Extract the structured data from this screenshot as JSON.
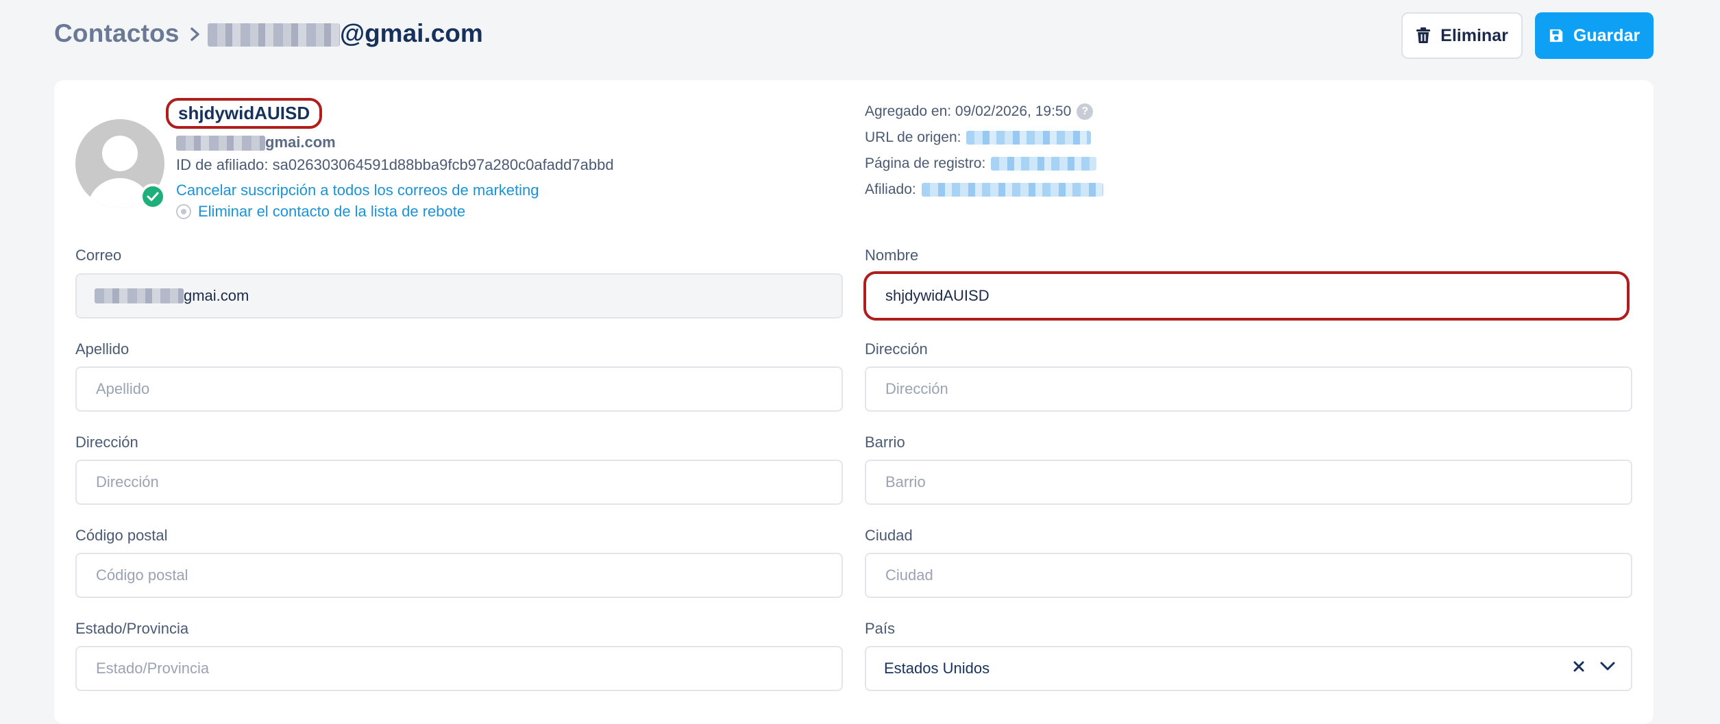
{
  "breadcrumb": {
    "root": "Contactos",
    "current_visible": "@gmai.com"
  },
  "actions": {
    "delete_label": "Eliminar",
    "save_label": "Guardar"
  },
  "profile": {
    "name": "shjdywidAUISD",
    "email_visible": "gmai.com",
    "affiliate_id": "ID de afiliado: sa026303064591d88bba9fcb97a280c0afadd7abbd",
    "unsubscribe_link": "Cancelar suscripción a todos los correos de marketing",
    "remove_bounce_link": "Eliminar el contacto de la lista de rebote"
  },
  "meta": {
    "added_on": "Agregado en: 09/02/2026, 19:50",
    "origin_url_label": "URL de origen:",
    "signup_page_label": "Página de registro:",
    "affiliate_label": "Afiliado:"
  },
  "form": {
    "email": {
      "label": "Correo",
      "value_visible": "gmai.com"
    },
    "first_name": {
      "label": "Nombre",
      "value": "shjdywidAUISD"
    },
    "last_name": {
      "label": "Apellido",
      "placeholder": "Apellido"
    },
    "address": {
      "label": "Dirección",
      "placeholder": "Dirección"
    },
    "address2": {
      "label": "Dirección",
      "placeholder": "Dirección"
    },
    "neighborhood": {
      "label": "Barrio",
      "placeholder": "Barrio"
    },
    "postal_code": {
      "label": "Código postal",
      "placeholder": "Código postal"
    },
    "city": {
      "label": "Ciudad",
      "placeholder": "Ciudad"
    },
    "state": {
      "label": "Estado/Provincia",
      "placeholder": "Estado/Provincia"
    },
    "country": {
      "label": "País",
      "value": "Estados Unidos"
    }
  },
  "colors": {
    "accent": "#0ea0f5",
    "highlight_border": "#b01d1d",
    "verified": "#1eb07a",
    "link": "#1a93d9"
  }
}
